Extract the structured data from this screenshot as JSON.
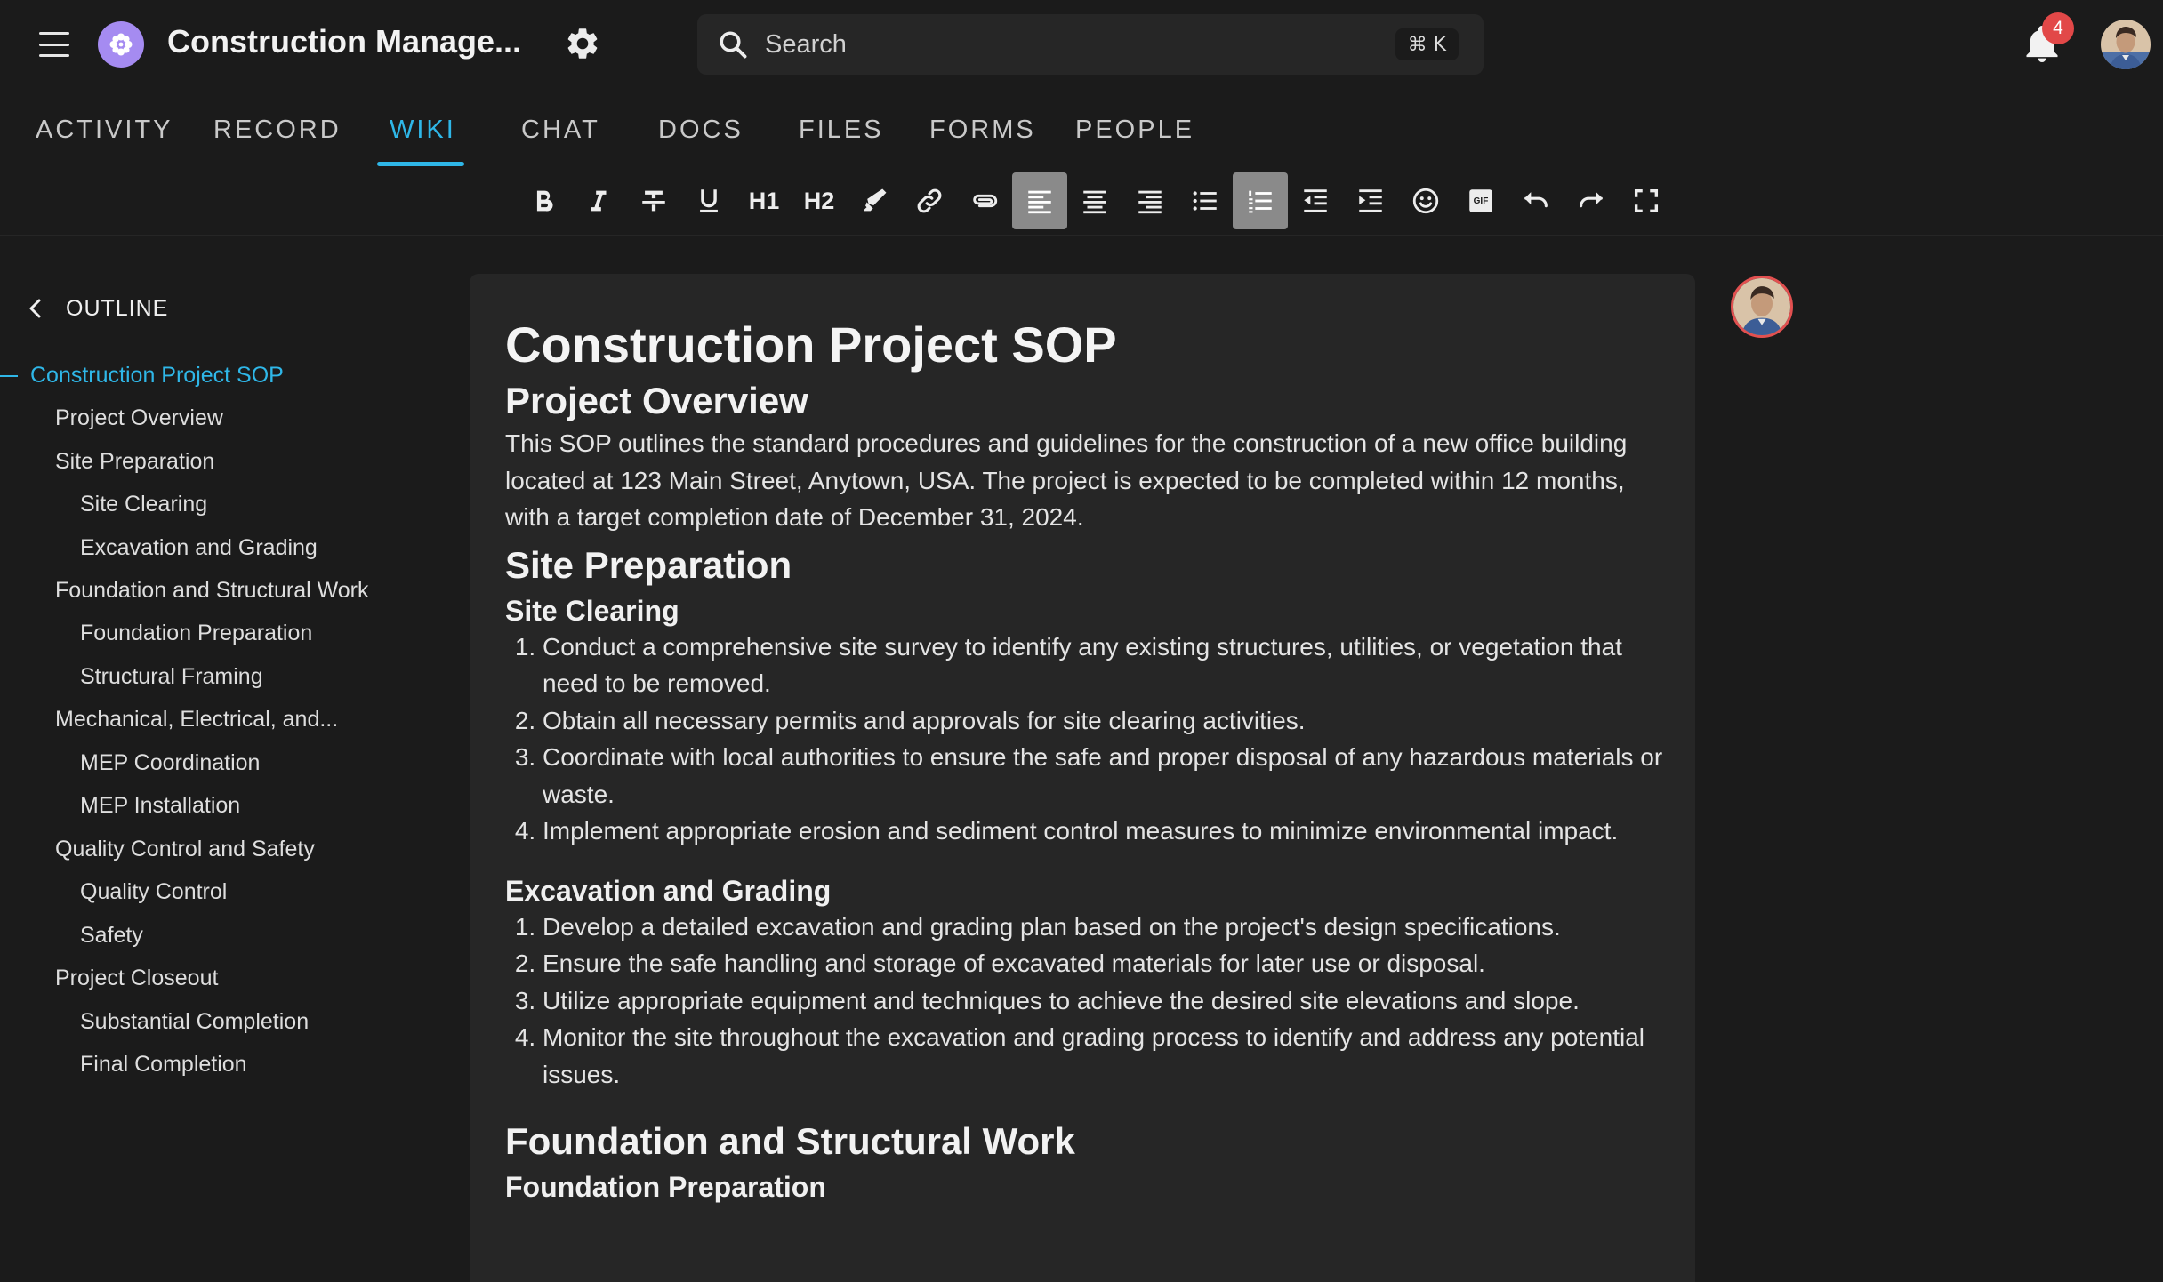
{
  "header": {
    "title": "Construction Manage...",
    "search": {
      "placeholder": "Search",
      "shortcut": "⌘ K"
    },
    "notifications": {
      "count": "4"
    }
  },
  "tabs": [
    {
      "label": "ACTIVITY"
    },
    {
      "label": "RECORD"
    },
    {
      "label": "WIKI",
      "active": true
    },
    {
      "label": "CHAT"
    },
    {
      "label": "DOCS"
    },
    {
      "label": "FILES"
    },
    {
      "label": "FORMS"
    },
    {
      "label": "PEOPLE"
    }
  ],
  "toolbar": {
    "h1_label": "H1",
    "h2_label": "H2",
    "gif_label": "GIF",
    "tools": [
      "bold",
      "italic",
      "strikethrough",
      "underline",
      "heading-1",
      "heading-2",
      "highlight",
      "link",
      "attachment",
      "align-left",
      "align-center",
      "align-right",
      "bullet-list",
      "numbered-list",
      "outdent",
      "indent",
      "emoji",
      "gif",
      "undo",
      "redo",
      "fullscreen"
    ],
    "active_tools": [
      "align-left",
      "numbered-list"
    ]
  },
  "outline": {
    "title": "OUTLINE",
    "items": [
      {
        "label": "Construction Project SOP",
        "level": 0
      },
      {
        "label": "Project Overview",
        "level": 1
      },
      {
        "label": "Site Preparation",
        "level": 1
      },
      {
        "label": "Site Clearing",
        "level": 2
      },
      {
        "label": "Excavation and Grading",
        "level": 2
      },
      {
        "label": "Foundation and Structural Work",
        "level": 1
      },
      {
        "label": "Foundation Preparation",
        "level": 2
      },
      {
        "label": "Structural Framing",
        "level": 2
      },
      {
        "label": "Mechanical, Electrical, and...",
        "level": 1
      },
      {
        "label": "MEP Coordination",
        "level": 2
      },
      {
        "label": "MEP Installation",
        "level": 2
      },
      {
        "label": "Quality Control and Safety",
        "level": 1
      },
      {
        "label": "Quality Control",
        "level": 2
      },
      {
        "label": "Safety",
        "level": 2
      },
      {
        "label": "Project Closeout",
        "level": 1
      },
      {
        "label": "Substantial Completion",
        "level": 2
      },
      {
        "label": "Final Completion",
        "level": 2
      }
    ]
  },
  "document": {
    "title": "Construction Project SOP",
    "overview_heading": "Project Overview",
    "overview_text": "This SOP outlines the standard procedures and guidelines for the construction of a new office building located at 123 Main Street, Anytown, USA. The project is expected to be completed within 12 months, with a target completion date of December 31, 2024.",
    "site_prep_heading": "Site Preparation",
    "site_clearing_heading": "Site Clearing",
    "site_clearing_steps": [
      "Conduct a comprehensive site survey to identify any existing structures, utilities, or vegetation that need to be removed.",
      "Obtain all necessary permits and approvals for site clearing activities.",
      "Coordinate with local authorities to ensure the safe and proper disposal of any hazardous materials or waste.",
      "Implement appropriate erosion and sediment control measures to minimize environmental impact."
    ],
    "excavation_heading": "Excavation and Grading",
    "excavation_steps": [
      "Develop a detailed excavation and grading plan based on the project's design specifications.",
      "Ensure the safe handling and storage of excavated materials for later use or disposal.",
      "Utilize appropriate equipment and techniques to achieve the desired site elevations and slope.",
      "Monitor the site throughout the excavation and grading process to identify and address any potential issues."
    ],
    "foundation_heading": "Foundation and Structural Work",
    "foundation_prep_heading": "Foundation Preparation"
  },
  "colors": {
    "accent": "#2fb7e8",
    "background": "#1b1b1b",
    "panel": "#262626",
    "badge": "#e24848",
    "logo": "#a58bf1"
  }
}
